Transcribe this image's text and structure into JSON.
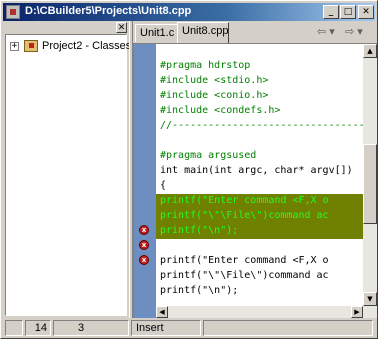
{
  "window": {
    "title": "D:\\CBuilder5\\Projects\\Unit8.cpp",
    "minimize_glyph": "_",
    "maximize_glyph": "□",
    "close_glyph": "✕"
  },
  "class_explorer": {
    "close_glyph": "✕",
    "expander_glyph": "+",
    "item_label": "Project2 - Classes",
    "item_icon": "project-icon"
  },
  "tabs": [
    {
      "label": "Unit1.c",
      "active": false
    },
    {
      "label": "Unit8.cpp",
      "active": true
    }
  ],
  "nav": {
    "back_glyph": "⇦ ▾",
    "forward_glyph": "⇨ ▾"
  },
  "code": {
    "lines": [
      {
        "text": "",
        "kind": "normal"
      },
      {
        "text": "#pragma hdrstop",
        "kind": "dir"
      },
      {
        "text": "#include <stdio.h>",
        "kind": "dir"
      },
      {
        "text": "#include <conio.h>",
        "kind": "dir"
      },
      {
        "text": "#include <condefs.h>",
        "kind": "dir"
      },
      {
        "text": "//----------------------------------",
        "kind": "dir"
      },
      {
        "text": "",
        "kind": "normal"
      },
      {
        "text": "#pragma argsused",
        "kind": "dir"
      },
      {
        "text": "int main(int argc, char* argv[])",
        "kind": "normal"
      },
      {
        "text": "{",
        "kind": "normal"
      },
      {
        "text": "printf(\"Enter command <F,X o",
        "kind": "err"
      },
      {
        "text": "printf(\"\\\"\\File\\\")command ac",
        "kind": "err"
      },
      {
        "text": "printf(\"\\n\");",
        "kind": "err"
      },
      {
        "text": "",
        "kind": "normal"
      },
      {
        "text": "printf(\"Enter command <F,X o",
        "kind": "normal"
      },
      {
        "text": "printf(\"\\\"\\File\\\")command ac",
        "kind": "normal"
      },
      {
        "text": "printf(\"\\n\");",
        "kind": "normal"
      }
    ],
    "error_marker_glyph": "x",
    "colors": {
      "error_highlight": "#708000",
      "error_text": "#20ff20",
      "directive": "#008000",
      "gutter": "#6c8ec0"
    }
  },
  "scrollbars": {
    "up_glyph": "▲",
    "down_glyph": "▼",
    "left_glyph": "◀",
    "right_glyph": "▶"
  },
  "status": {
    "line": "14",
    "col": "3",
    "mode": "Insert"
  }
}
